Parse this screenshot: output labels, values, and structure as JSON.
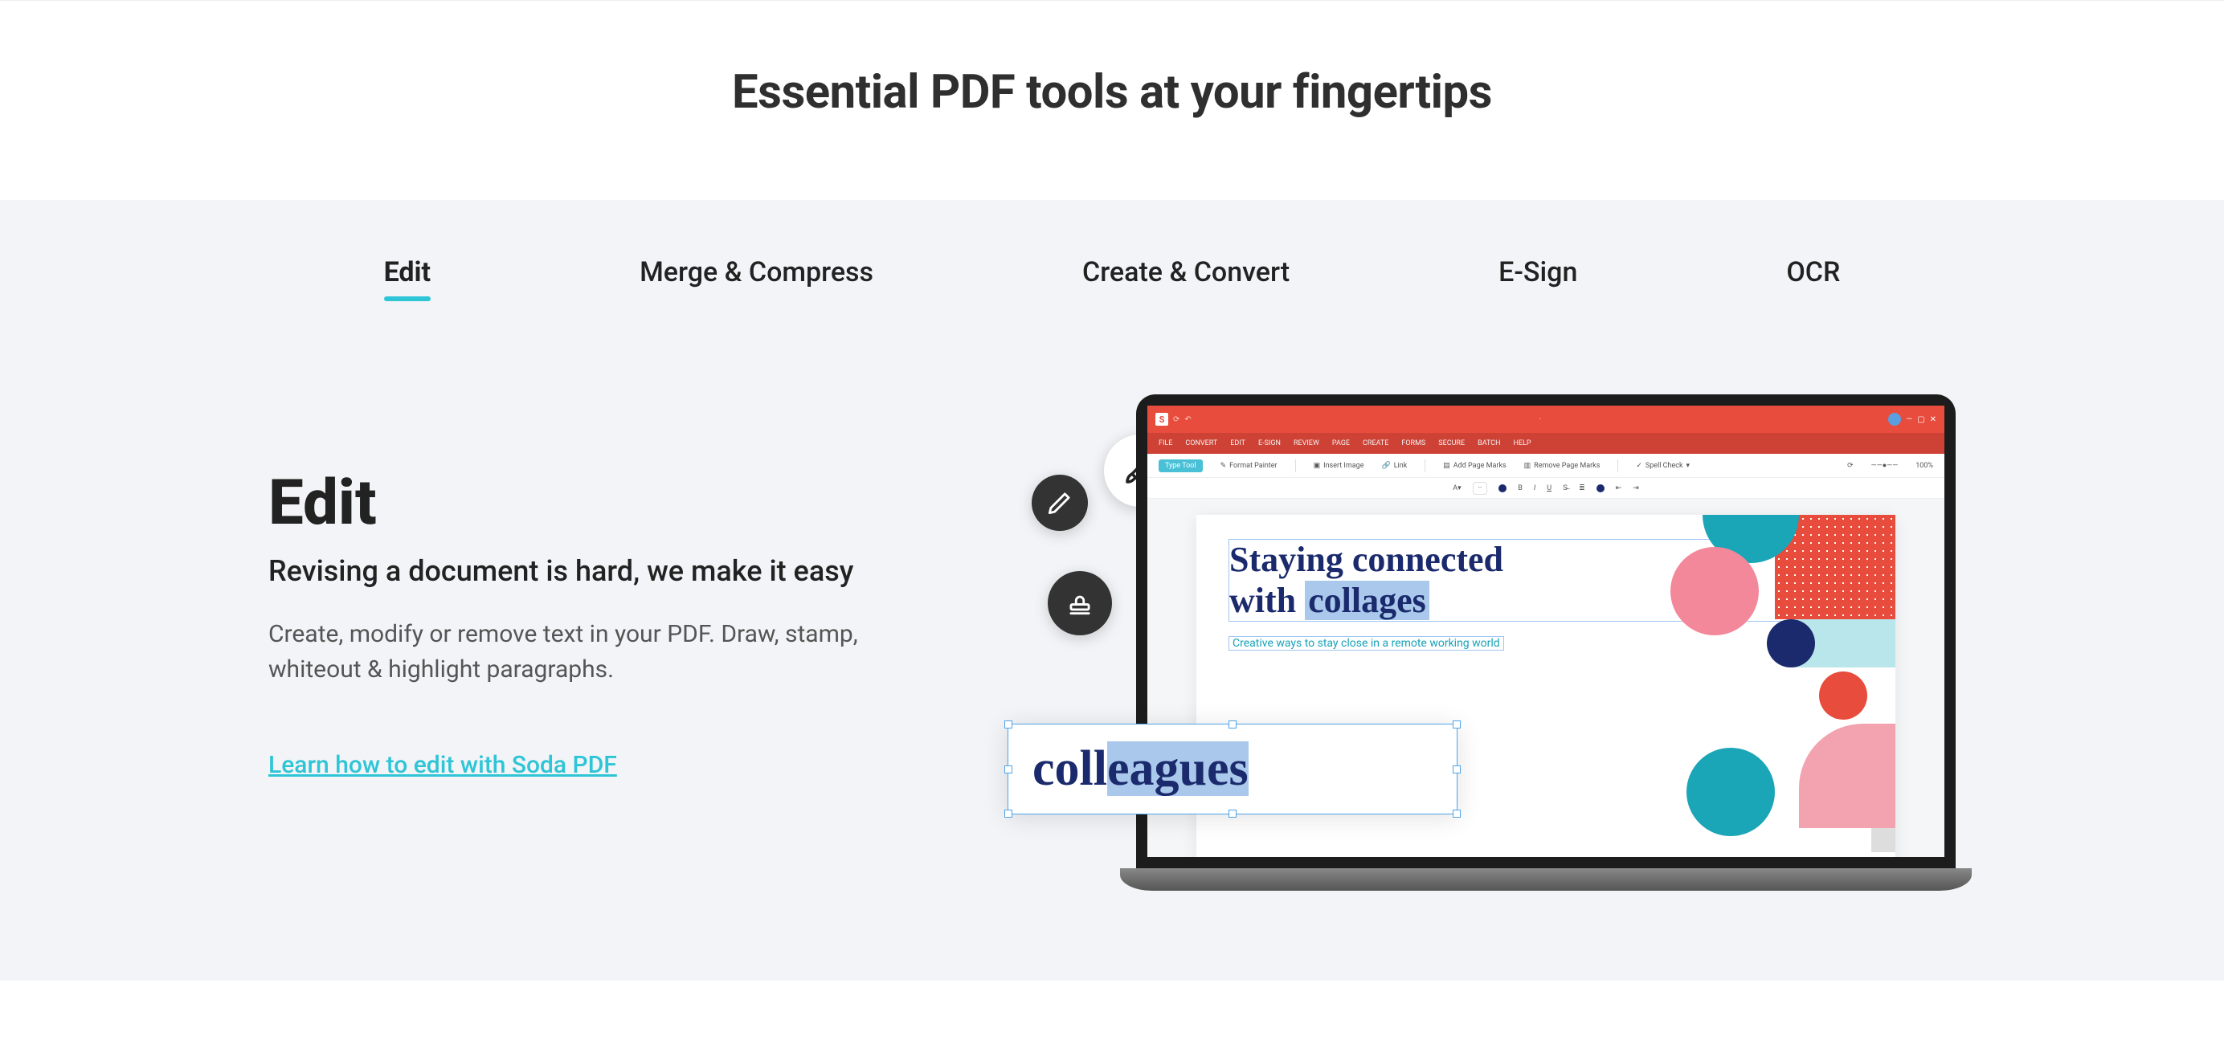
{
  "hero": {
    "title": "Essential PDF tools at your fingertips"
  },
  "tabs": [
    {
      "label": "Edit",
      "active": true
    },
    {
      "label": "Merge & Compress",
      "active": false
    },
    {
      "label": "Create & Convert",
      "active": false
    },
    {
      "label": "E-Sign",
      "active": false
    },
    {
      "label": "OCR",
      "active": false
    }
  ],
  "panel": {
    "heading": "Edit",
    "subheading": "Revising a document is hard, we make it easy",
    "description": "Create, modify or remove text in your PDF. Draw, stamp, whiteout & highlight paragraphs.",
    "link_label": "Learn how to edit with Soda PDF"
  },
  "app": {
    "toolbar": {
      "format_painter": "Format Painter",
      "insert_image": "Insert Image",
      "link": "Link",
      "add_page_marks": "Add Page Marks",
      "remove_page_marks": "Remove Page Marks",
      "spell_check": "Spell Check",
      "zoom": "100%"
    },
    "document": {
      "title_line1": "Staying connected",
      "title_line2_prefix": "with ",
      "title_line2_highlight": "collages",
      "subtitle": "Creative ways to stay close in a remote working world"
    },
    "popup": {
      "prefix": "coll",
      "highlight": "eagues"
    }
  }
}
